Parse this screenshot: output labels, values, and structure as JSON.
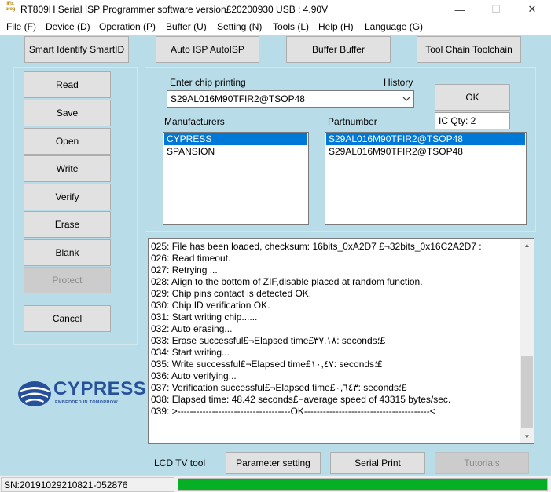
{
  "window": {
    "icon_lines": [
      "iFlx",
      "prog"
    ],
    "title": "RT809H Serial ISP Programmer software version£20200930‎‎ USB : 4.90V",
    "min_glyph": "—",
    "max_glyph": "☐",
    "close_glyph": "✕"
  },
  "menu": [
    "File (F)",
    "Device (D)",
    "Operation (P)",
    "Buffer (U)",
    "Setting (N)",
    "Tools (L)",
    "Help (H)",
    "Language (G)"
  ],
  "toolbar": {
    "smart_identify": "Smart Identify SmartID",
    "auto_isp": "Auto ISP AutoISP",
    "buffer": "Buffer Buffer",
    "tool_chain": "Tool Chain Toolchain"
  },
  "ops": {
    "read": "Read",
    "save": "Save",
    "open": "Open",
    "write": "Write",
    "verify": "Verify",
    "erase": "Erase",
    "blank": "Blank",
    "protect": "Protect",
    "cancel": "Cancel"
  },
  "chip": {
    "enter_label": "Enter chip printing",
    "history_label": "History",
    "value": "S29AL016M90TFIR2@TSOP48",
    "ok_label": "OK",
    "ic_qty": "IC Qty: 2"
  },
  "manufacturers": {
    "label": "Manufacturers",
    "items": [
      "CYPRESS",
      "SPANSION"
    ],
    "selected_index": 0
  },
  "partnumber": {
    "label": "Partnumber",
    "items": [
      "S29AL016M90TFIR2@TSOP48",
      "S29AL016M90TFIR2@TSOP48"
    ],
    "selected_index": 0
  },
  "log": [
    "025:  File has been loaded, checksum: 16bits_0xA2D7 £¬32bits_0x16C2A2D7 :",
    "026:  Read timeout.",
    "027:  Retrying ...",
    "028:  Align to the bottom of ZIF,disable placed at random function.",
    "029:  Chip pins contact is detected OK.",
    "030:  Chip ID verification OK.",
    "031:  Start writing chip......",
    "032:  Auto erasing...",
    "033:  Erase successful£¬Elapsed time£٣٧,١٨: seconds؛£",
    "034:  Start writing...",
    "035:  Write successful£¬Elapsed time£١٠,٤٧: seconds؛£",
    "036:  Auto verifying...",
    "037:  Verification successful£¬Elapsed time£٠,٦٤٣: seconds؛£",
    "038:  Elapsed time: 48.42 seconds£¬average speed of 43315 bytes/sec.",
    "039:  >------------------------------------OK----------------------------------------<"
  ],
  "bottom": {
    "lcd_label": "LCD TV tool",
    "parameter_setting": "Parameter setting",
    "serial_print": "Serial Print",
    "tutorials": "Tutorials"
  },
  "logo": {
    "name": "CYPRESS",
    "tagline": "EMBEDDED IN TOMORROW",
    "color": "#27509b"
  },
  "status": {
    "sn": "SN:20191029210821-052876",
    "progress": 1.0,
    "progress_color": "#06b025"
  }
}
